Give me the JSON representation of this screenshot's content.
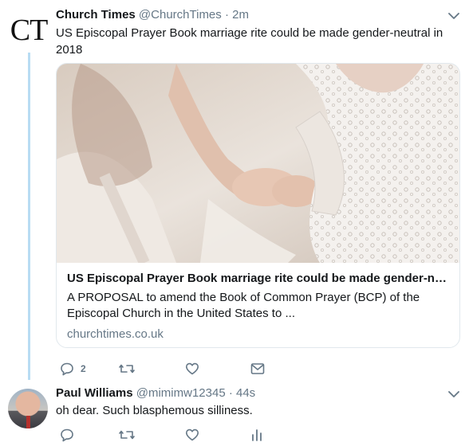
{
  "colors": {
    "thread": "#b8dcf3",
    "muted": "#657786",
    "text": "#14171a",
    "border": "#e1e8ed"
  },
  "tweet1": {
    "avatar_text": "CT",
    "display_name": "Church Times",
    "handle": "@ChurchTimes",
    "separator": "·",
    "time": "2m",
    "text": "US Episcopal Prayer Book marriage rite could be made gender-neutral in 2018",
    "card": {
      "title": "US Episcopal Prayer Book marriage rite could be made gender-neutr...",
      "description": "A PROPOSAL to amend the Book of Common Prayer (BCP) of the Episcopal Church in the United States to ...",
      "domain": "churchtimes.co.uk"
    },
    "actions": {
      "reply_count": "2",
      "retweet_count": "",
      "like_count": ""
    }
  },
  "tweet2": {
    "display_name": "Paul Williams",
    "handle": "@mimimw12345",
    "separator": "·",
    "time": "44s",
    "text": "oh dear. Such blasphemous silliness."
  },
  "icons": [
    "reply-icon",
    "retweet-icon",
    "like-icon",
    "dm-icon",
    "analytics-icon",
    "chevron-down-icon"
  ]
}
